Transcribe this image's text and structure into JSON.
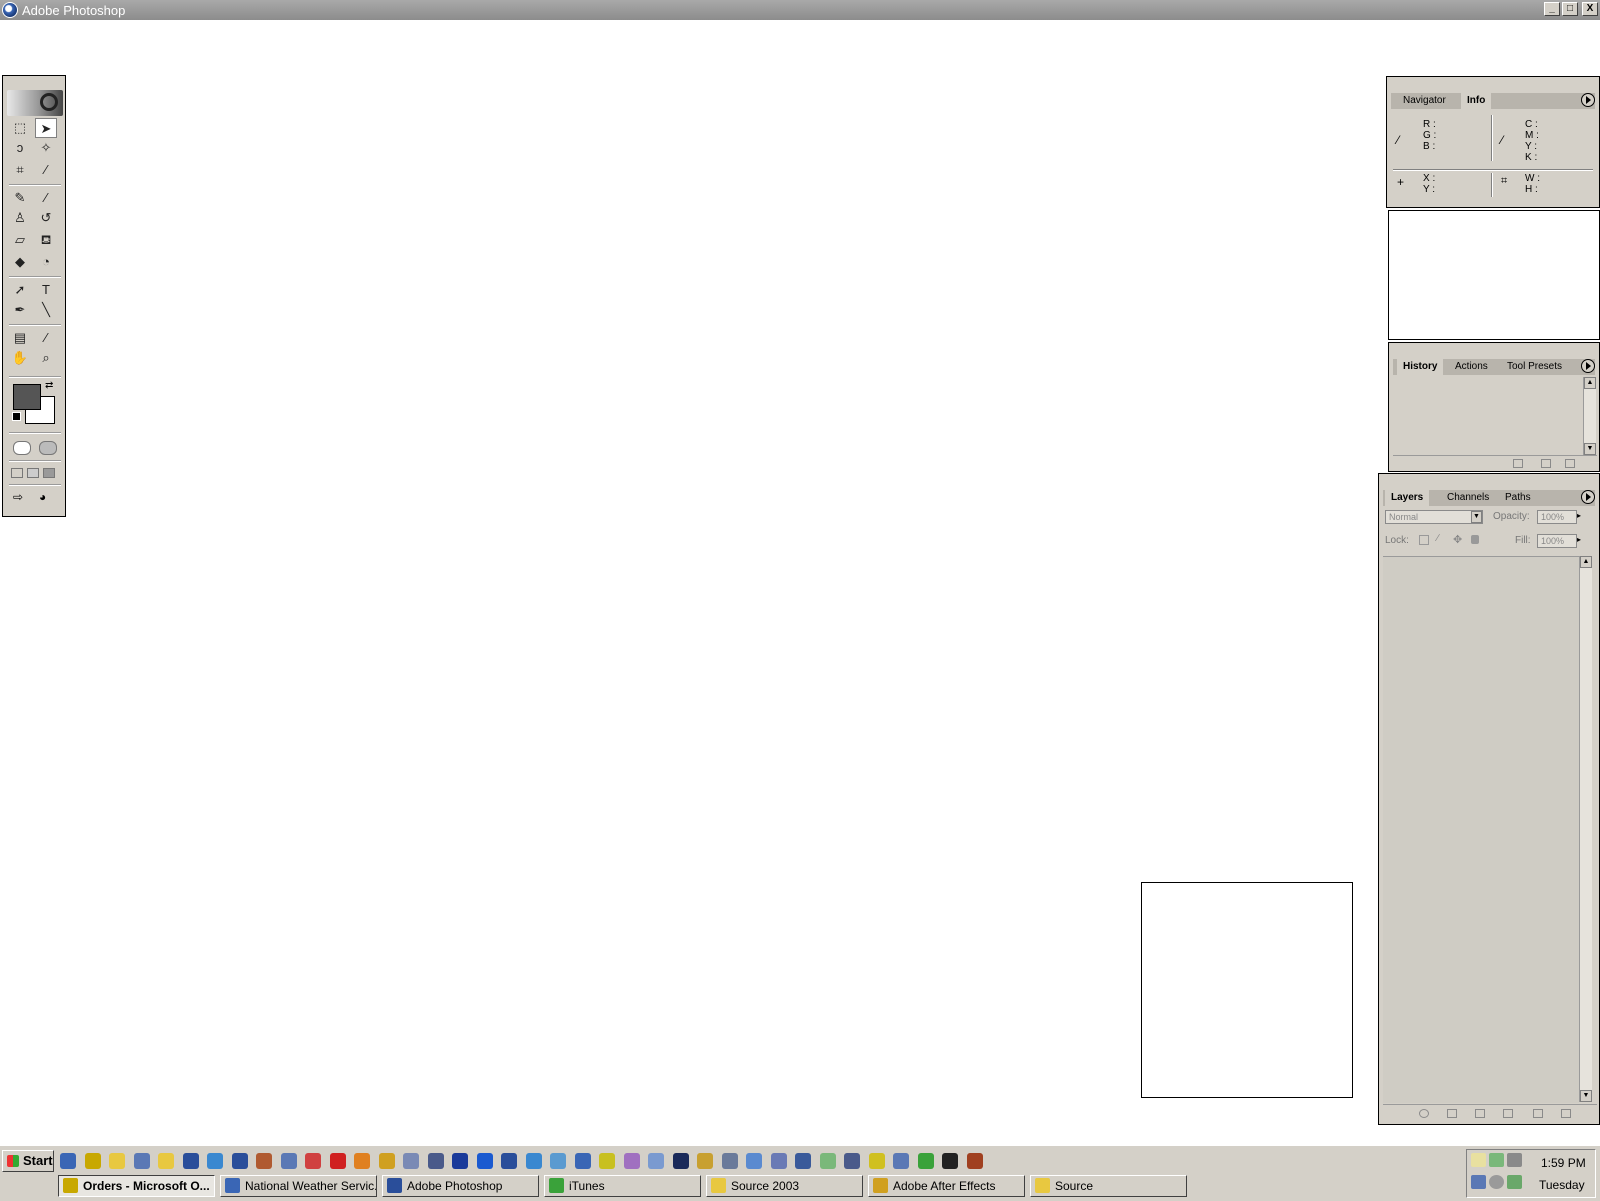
{
  "window": {
    "title": "Adobe Photoshop",
    "minimize": "_",
    "maximize": "□",
    "close": "X"
  },
  "toolbox": {
    "tools": [
      {
        "name": "rectangular-marquee-tool",
        "glyph": "⬚"
      },
      {
        "name": "move-tool",
        "glyph": "➤"
      },
      {
        "name": "lasso-tool",
        "glyph": "ↄ"
      },
      {
        "name": "magic-wand-tool",
        "glyph": "✧"
      },
      {
        "name": "crop-tool",
        "glyph": "⌗"
      },
      {
        "name": "slice-tool",
        "glyph": "⁄"
      },
      {
        "name": "healing-brush-tool",
        "glyph": "✎"
      },
      {
        "name": "brush-tool",
        "glyph": "∕"
      },
      {
        "name": "clone-stamp-tool",
        "glyph": "♙"
      },
      {
        "name": "history-brush-tool",
        "glyph": "↺"
      },
      {
        "name": "eraser-tool",
        "glyph": "▱"
      },
      {
        "name": "paint-bucket-tool",
        "glyph": "⛾"
      },
      {
        "name": "blur-tool",
        "glyph": "◆"
      },
      {
        "name": "dodge-tool",
        "glyph": "◔"
      },
      {
        "name": "path-selection-tool",
        "glyph": "➚"
      },
      {
        "name": "type-tool",
        "glyph": "T"
      },
      {
        "name": "pen-tool",
        "glyph": "✒"
      },
      {
        "name": "line-tool",
        "glyph": "╲"
      },
      {
        "name": "notes-tool",
        "glyph": "▤"
      },
      {
        "name": "eyedropper-tool",
        "glyph": "⁄"
      },
      {
        "name": "hand-tool",
        "glyph": "✋"
      },
      {
        "name": "zoom-tool",
        "glyph": "⌕"
      }
    ],
    "colors": {
      "foreground": "#555555",
      "background": "#ffffff"
    }
  },
  "info_palette": {
    "tabs": [
      "Navigator",
      "Info"
    ],
    "active_tab": "Info",
    "rgb_labels": [
      "R :",
      "G :",
      "B :"
    ],
    "cmyk_labels": [
      "C :",
      "M :",
      "Y :",
      "K :"
    ],
    "xy_labels": [
      "X :",
      "Y :"
    ],
    "wh_labels": [
      "W :",
      "H :"
    ]
  },
  "history_palette": {
    "tabs": [
      "History",
      "Actions",
      "Tool Presets"
    ],
    "active_tab": "History"
  },
  "layers_palette": {
    "tabs": [
      "Layers",
      "Channels",
      "Paths"
    ],
    "active_tab": "Layers",
    "blend_mode": "Normal",
    "opacity_label": "Opacity:",
    "opacity_value": "100%",
    "lock_label": "Lock:",
    "fill_label": "Fill:",
    "fill_value": "100%"
  },
  "taskbar": {
    "start_label": "Start",
    "quick_launch_count": 38,
    "tasks": [
      {
        "label": "Orders - Microsoft O...",
        "active": true,
        "color": "#c8a800"
      },
      {
        "label": "National Weather Servic...",
        "active": false,
        "color": "#3a66b5"
      },
      {
        "label": "Adobe Photoshop",
        "active": false,
        "color": "#2a4e9a"
      },
      {
        "label": "iTunes",
        "active": false,
        "color": "#3aa23a"
      },
      {
        "label": "Source 2003",
        "active": false,
        "color": "#e8c840"
      },
      {
        "label": "Adobe After Effects",
        "active": false,
        "color": "#d0a020"
      },
      {
        "label": "Source",
        "active": false,
        "color": "#e8c840"
      }
    ],
    "clock": {
      "time": "1:59 PM",
      "day": "Tuesday"
    }
  }
}
